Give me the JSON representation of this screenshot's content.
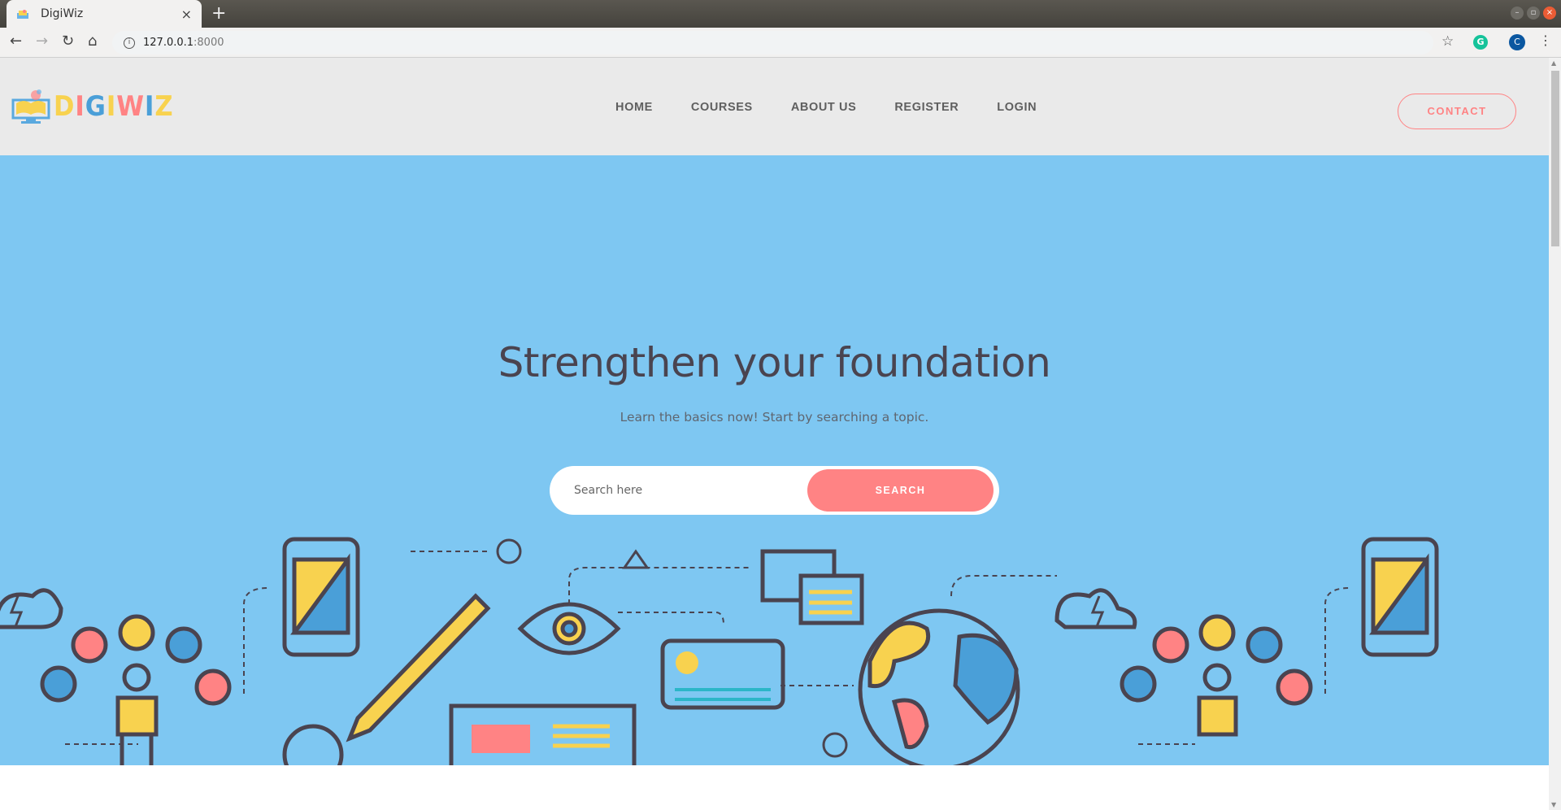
{
  "browser": {
    "tab_title": "DigiWiz",
    "tab_close": "×",
    "new_tab": "+",
    "url_host": "127.0.0.1",
    "url_port": ":8000",
    "profile_initial": "C",
    "grammarly_initial": "G"
  },
  "header": {
    "logo_letters": [
      "D",
      "I",
      "G",
      "I",
      "W",
      "I",
      "Z"
    ],
    "logo_colors": [
      "#f8d24f",
      "#ff8384",
      "#4a9fd8",
      "#f8d24f",
      "#ff8384",
      "#4a9fd8",
      "#f8d24f"
    ],
    "nav": [
      "HOME",
      "COURSES",
      "ABOUT US",
      "REGISTER",
      "LOGIN"
    ],
    "contact_label": "CONTACT"
  },
  "hero": {
    "title": "Strengthen your foundation",
    "subtitle": "Learn the basics now! Start by searching a topic.",
    "search_placeholder": "Search here",
    "search_button": "SEARCH"
  },
  "colors": {
    "accent": "#ff8384",
    "hero_bg": "#7ec7f2",
    "header_bg": "#eaeaea",
    "yellow": "#f8d24f",
    "blue": "#4a9fd8",
    "outline": "#4a4450"
  }
}
